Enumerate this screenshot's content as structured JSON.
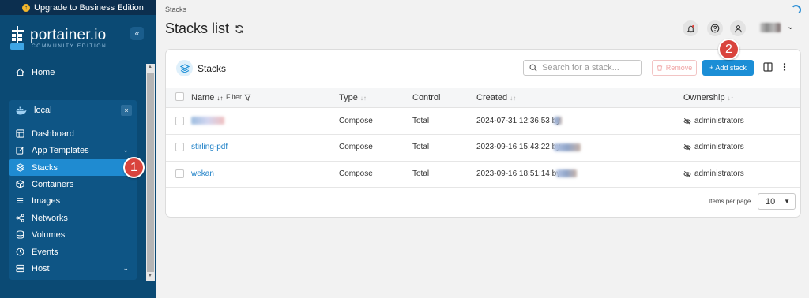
{
  "upgrade": {
    "label": "Upgrade to Business Edition"
  },
  "logo": {
    "name": "portainer.io",
    "edition": "COMMUNITY EDITION"
  },
  "sidebar": {
    "collapse_symbol": "«",
    "home": "Home",
    "environment": {
      "name": "local",
      "close_symbol": "×"
    },
    "items": [
      {
        "label": "Dashboard",
        "icon": "dashboard-icon"
      },
      {
        "label": "App Templates",
        "icon": "edit-icon",
        "chevron": "⌄"
      },
      {
        "label": "Stacks",
        "icon": "stacks-icon",
        "active": true
      },
      {
        "label": "Containers",
        "icon": "box-icon"
      },
      {
        "label": "Images",
        "icon": "list-icon"
      },
      {
        "label": "Networks",
        "icon": "share-icon"
      },
      {
        "label": "Volumes",
        "icon": "database-icon"
      },
      {
        "label": "Events",
        "icon": "clock-icon"
      },
      {
        "label": "Host",
        "icon": "server-icon",
        "chevron": "⌄"
      }
    ]
  },
  "callouts": [
    "1",
    "2"
  ],
  "header": {
    "breadcrumb": "Stacks",
    "title": "Stacks list",
    "user_chevron": "⌄"
  },
  "panel": {
    "title": "Stacks",
    "search_placeholder": "Search for a stack...",
    "remove_label": "Remove",
    "add_label": "+ Add stack",
    "kebab": "⋮",
    "columns": {
      "name": "Name",
      "filter": "Filter",
      "type": "Type",
      "control": "Control",
      "created": "Created",
      "ownership": "Ownership"
    },
    "rows": [
      {
        "name": "",
        "type": "Compose",
        "control": "Total",
        "created": "2024-07-31 12:36:53 by",
        "ownership": "administrators"
      },
      {
        "name": "stirling-pdf",
        "type": "Compose",
        "control": "Total",
        "created": "2023-09-16 15:43:22 by",
        "ownership": "administrators"
      },
      {
        "name": "wekan",
        "type": "Compose",
        "control": "Total",
        "created": "2023-09-16 18:51:14 by",
        "ownership": "administrators"
      }
    ],
    "items_per_page_label": "Items per page",
    "items_per_page": "10"
  },
  "colors": {
    "sidebar": "#0b4a74",
    "active": "#1f8bd1",
    "primary": "#1b8ed6",
    "callout": "#d9443d"
  }
}
